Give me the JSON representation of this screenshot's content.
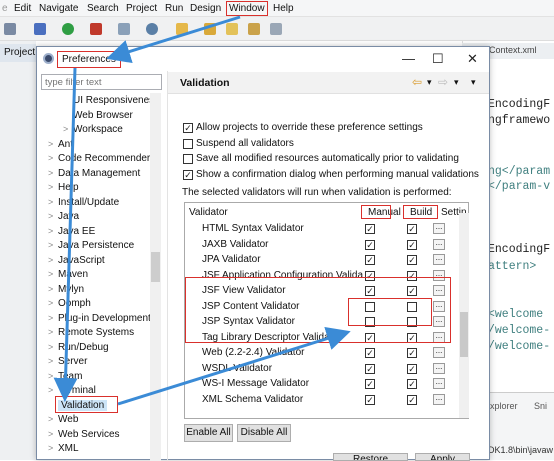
{
  "menubar": {
    "items": [
      "Edit",
      "Navigate",
      "Search",
      "Project",
      "Run",
      "Design",
      "Window",
      "Help"
    ],
    "highlighted": "Window"
  },
  "left_panel": {
    "tab_label": "Project"
  },
  "editor": {
    "tab_label": "nContext.xml",
    "lines": [
      {
        "text": "EncodingF",
        "style": "plain"
      },
      {
        "text": "ngframewo",
        "style": "plain"
      },
      {
        "text": "ng</param",
        "style": "tag"
      },
      {
        "text": "</param-v",
        "style": "tag"
      },
      {
        "text": "EncodingF",
        "style": "plain"
      },
      {
        "text": "attern>",
        "style": "tag"
      },
      {
        "text": "<welcome",
        "style": "tag"
      },
      {
        "text": "/welcome-",
        "style": "tag"
      },
      {
        "text": "/welcome-",
        "style": "tag"
      }
    ],
    "bottom": {
      "tab": "xplorer",
      "tab2": "Sni",
      "path": "DK1.8\\bin\\javaw"
    }
  },
  "dialog": {
    "title": "Preferences",
    "controls": {
      "minimize": "—",
      "maximize": "☐",
      "close": "✕"
    },
    "filter_placeholder": "type filter text",
    "tree": [
      {
        "label": "UI Responsiveness",
        "indent": 2,
        "chev": ""
      },
      {
        "label": "Web Browser",
        "indent": 2,
        "chev": ""
      },
      {
        "label": "Workspace",
        "indent": 2,
        "chev": ">"
      },
      {
        "label": "Ant",
        "indent": 1,
        "chev": ">"
      },
      {
        "label": "Code Recommenders",
        "indent": 1,
        "chev": ">"
      },
      {
        "label": "Data Management",
        "indent": 1,
        "chev": ">"
      },
      {
        "label": "Help",
        "indent": 1,
        "chev": ">"
      },
      {
        "label": "Install/Update",
        "indent": 1,
        "chev": ">"
      },
      {
        "label": "Java",
        "indent": 1,
        "chev": ">"
      },
      {
        "label": "Java EE",
        "indent": 1,
        "chev": ">"
      },
      {
        "label": "Java Persistence",
        "indent": 1,
        "chev": ">"
      },
      {
        "label": "JavaScript",
        "indent": 1,
        "chev": ">"
      },
      {
        "label": "Maven",
        "indent": 1,
        "chev": ">"
      },
      {
        "label": "Mylyn",
        "indent": 1,
        "chev": ">"
      },
      {
        "label": "Oomph",
        "indent": 1,
        "chev": ">"
      },
      {
        "label": "Plug-in Development",
        "indent": 1,
        "chev": ">"
      },
      {
        "label": "Remote Systems",
        "indent": 1,
        "chev": ">"
      },
      {
        "label": "Run/Debug",
        "indent": 1,
        "chev": ">"
      },
      {
        "label": "Server",
        "indent": 1,
        "chev": ">"
      },
      {
        "label": "Team",
        "indent": 1,
        "chev": ">"
      },
      {
        "label": "Terminal",
        "indent": 1,
        "chev": ">"
      },
      {
        "label": "Validation",
        "indent": 1,
        "chev": "",
        "selected": true
      },
      {
        "label": "Web",
        "indent": 1,
        "chev": ">"
      },
      {
        "label": "Web Services",
        "indent": 1,
        "chev": ">"
      },
      {
        "label": "XML",
        "indent": 1,
        "chev": ">"
      }
    ],
    "page_title": "Validation",
    "nav": {
      "back": "⇦",
      "forward": "⇨",
      "menu": "▾"
    },
    "options": [
      {
        "label": "Allow projects to override these preference settings",
        "checked": true
      },
      {
        "label": "Suspend all validators",
        "checked": false
      },
      {
        "label": "Save all modified resources automatically prior to validating",
        "checked": false
      },
      {
        "label": "Show a confirmation dialog when performing manual validations",
        "checked": true
      }
    ],
    "note": "The selected validators will run when validation is performed:",
    "columns": {
      "validator": "Validator",
      "manual": "Manual",
      "build": "Build",
      "settings": "Settin"
    },
    "validators": [
      {
        "name": "HTML Syntax Validator",
        "manual": true,
        "build": true
      },
      {
        "name": "JAXB Validator",
        "manual": true,
        "build": true
      },
      {
        "name": "JPA Validator",
        "manual": true,
        "build": true
      },
      {
        "name": "JSF Application Configuration Valida",
        "manual": true,
        "build": true
      },
      {
        "name": "JSF View Validator",
        "manual": true,
        "build": true
      },
      {
        "name": "JSP Content Validator",
        "manual": false,
        "build": false
      },
      {
        "name": "JSP Syntax Validator",
        "manual": false,
        "build": false
      },
      {
        "name": "Tag Library Descriptor Validator",
        "manual": true,
        "build": true
      },
      {
        "name": "Web (2.2-2.4) Validator",
        "manual": true,
        "build": true
      },
      {
        "name": "WSDL Validator",
        "manual": true,
        "build": true
      },
      {
        "name": "WS-I Message Validator",
        "manual": true,
        "build": true
      },
      {
        "name": "XML Schema Validator",
        "manual": true,
        "build": true
      }
    ],
    "settings_button": "...",
    "buttons": {
      "enable_all": "Enable All",
      "disable_all": "Disable All",
      "restore_defaults": "Restore Defaults",
      "apply": "Apply"
    },
    "annotation_color": "#d9302c",
    "arrow_color": "#3b8bd6"
  }
}
